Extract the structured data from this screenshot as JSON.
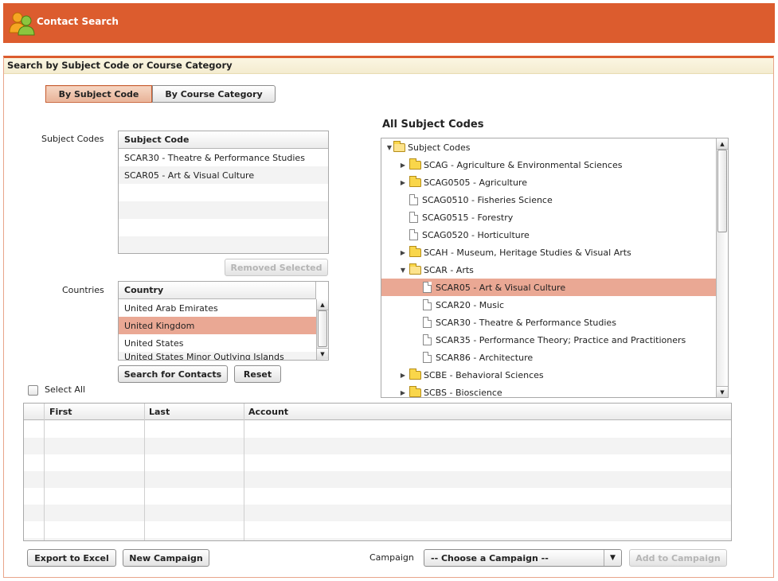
{
  "header": {
    "title": "Contact Search",
    "accent": "#dc5c2e",
    "logo_icon": "people-icon"
  },
  "panel": {
    "title": "Search by Subject Code or Course Category"
  },
  "toggle": {
    "by_subject": "By Subject Code",
    "by_category": "By Course Category",
    "active": "by_subject"
  },
  "subject_codes": {
    "label": "Subject Codes",
    "column": "Subject Code",
    "rows": [
      "SCAR30 - Theatre & Performance Studies",
      "SCAR05 - Art & Visual Culture"
    ],
    "remove_button": "Removed Selected"
  },
  "countries": {
    "label": "Countries",
    "column": "Country",
    "rows": [
      "United Arab Emirates",
      "United Kingdom",
      "United States",
      "United States Minor Outlying Islands"
    ],
    "selected": "United Kingdom"
  },
  "actions": {
    "search": "Search for Contacts",
    "reset": "Reset",
    "select_all": "Select All"
  },
  "tree": {
    "title": "All Subject Codes",
    "root": "Subject Codes",
    "items": [
      {
        "label": "SCAG - Agriculture & Environmental Sciences",
        "type": "folder",
        "expanded": false
      },
      {
        "label": "SCAG0505 - Agriculture",
        "type": "folder",
        "expanded": false
      },
      {
        "label": "SCAG0510 - Fisheries Science",
        "type": "doc"
      },
      {
        "label": "SCAG0515 - Forestry",
        "type": "doc"
      },
      {
        "label": "SCAG0520 - Horticulture",
        "type": "doc"
      },
      {
        "label": "SCAH - Museum, Heritage Studies & Visual Arts",
        "type": "folder",
        "expanded": false
      },
      {
        "label": "SCAR - Arts",
        "type": "folder",
        "expanded": true
      },
      {
        "label": "SCAR05 - Art & Visual Culture",
        "type": "doc",
        "child": true,
        "selected": true
      },
      {
        "label": "SCAR20 - Music",
        "type": "doc",
        "child": true
      },
      {
        "label": "SCAR30 - Theatre & Performance Studies",
        "type": "doc",
        "child": true
      },
      {
        "label": "SCAR35 - Performance Theory; Practice and Practitioners",
        "type": "doc",
        "child": true
      },
      {
        "label": "SCAR86 - Architecture",
        "type": "doc",
        "child": true
      },
      {
        "label": "SCBE - Behavioral Sciences",
        "type": "folder",
        "expanded": false
      },
      {
        "label": "SCBS - Bioscience",
        "type": "folder",
        "expanded": false
      }
    ]
  },
  "results": {
    "columns": [
      "First",
      "Last",
      "Account"
    ]
  },
  "footer": {
    "export": "Export to Excel",
    "new_campaign": "New Campaign",
    "campaign_label": "Campaign",
    "campaign_select": "-- Choose a Campaign --",
    "add": "Add to Campaign"
  }
}
